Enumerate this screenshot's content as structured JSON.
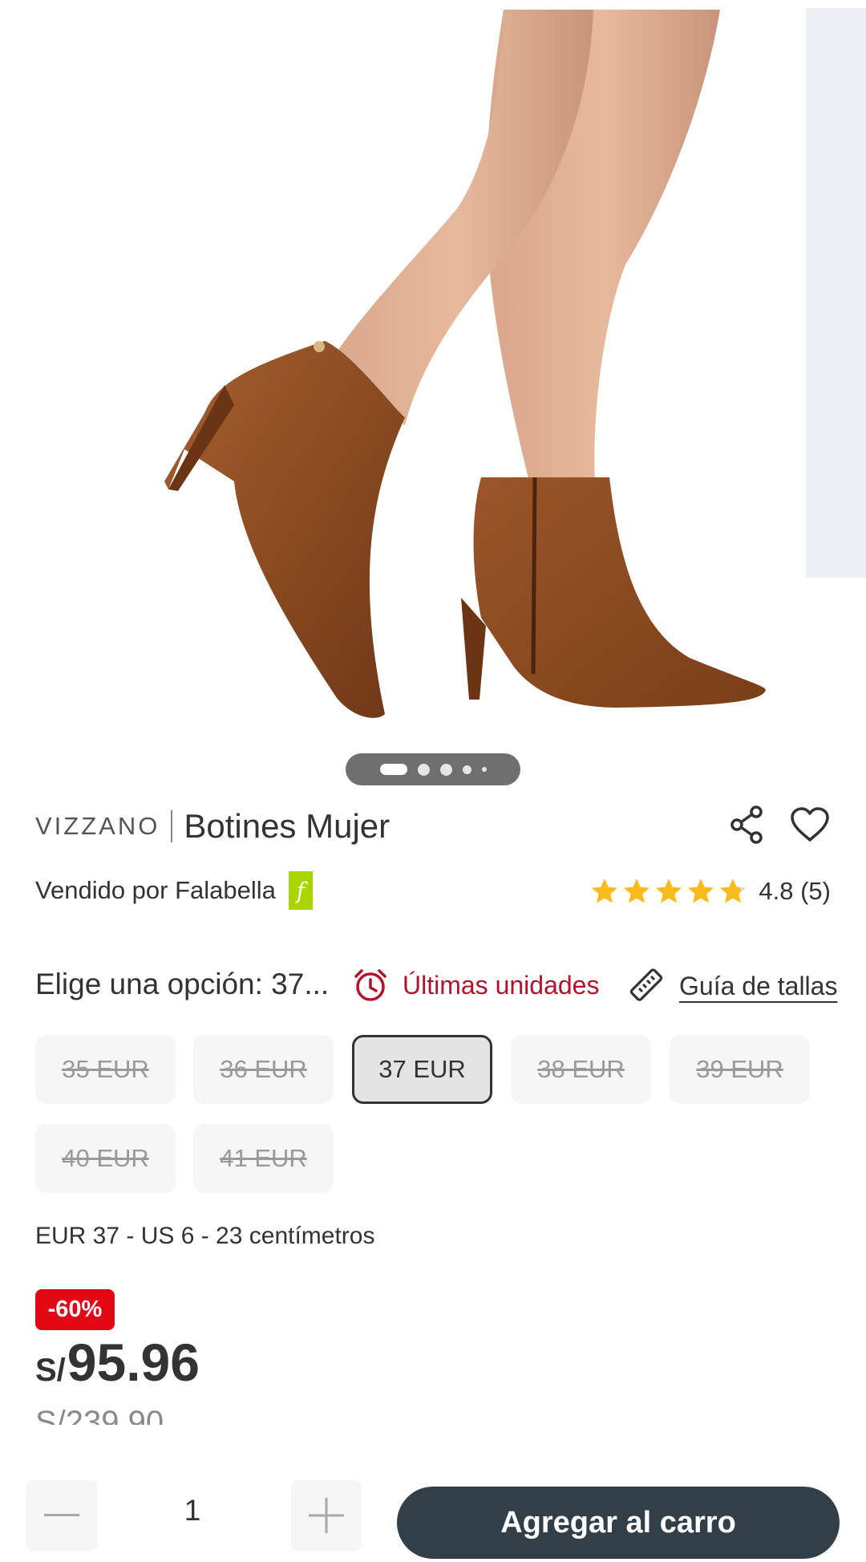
{
  "carousel": {
    "image_alt": "product-image-ankle-boots",
    "pages": 5,
    "current": 1
  },
  "product": {
    "brand": "VIZZANO",
    "name": "Botines Mujer",
    "seller_text": "Vendido por Falabella",
    "seller_badge": "f",
    "rating_value": "4.8 (5)",
    "rating_stars": 4.8
  },
  "options": {
    "label": "Elige una opción: 37...",
    "stock_text": "Últimas unidades",
    "size_guide": "Guía de tallas",
    "sizes": [
      {
        "label": "35 EUR",
        "available": false,
        "selected": false
      },
      {
        "label": "36 EUR",
        "available": false,
        "selected": false
      },
      {
        "label": "37 EUR",
        "available": true,
        "selected": true
      },
      {
        "label": "38 EUR",
        "available": false,
        "selected": false
      },
      {
        "label": "39 EUR",
        "available": false,
        "selected": false
      },
      {
        "label": "40 EUR",
        "available": false,
        "selected": false
      },
      {
        "label": "41 EUR",
        "available": false,
        "selected": false
      }
    ],
    "size_note": "EUR 37 - US 6 - 23 centímetros"
  },
  "price": {
    "discount": "-60%",
    "currency": "S/",
    "current": "95.96",
    "original": "S/239.90"
  },
  "cart": {
    "quantity": "1",
    "add_label": "Agregar al carro"
  },
  "colors": {
    "accent_red": "#e30613",
    "stock_red": "#b3122b",
    "cart_button": "#333f48",
    "falabella_green": "#aad500",
    "star": "#fcbb1b"
  },
  "icons": {
    "share": "share-icon",
    "favorite": "heart-icon",
    "alarm": "alarm-clock-icon",
    "ruler": "ruler-icon",
    "minus": "minus-icon",
    "plus": "plus-icon"
  }
}
